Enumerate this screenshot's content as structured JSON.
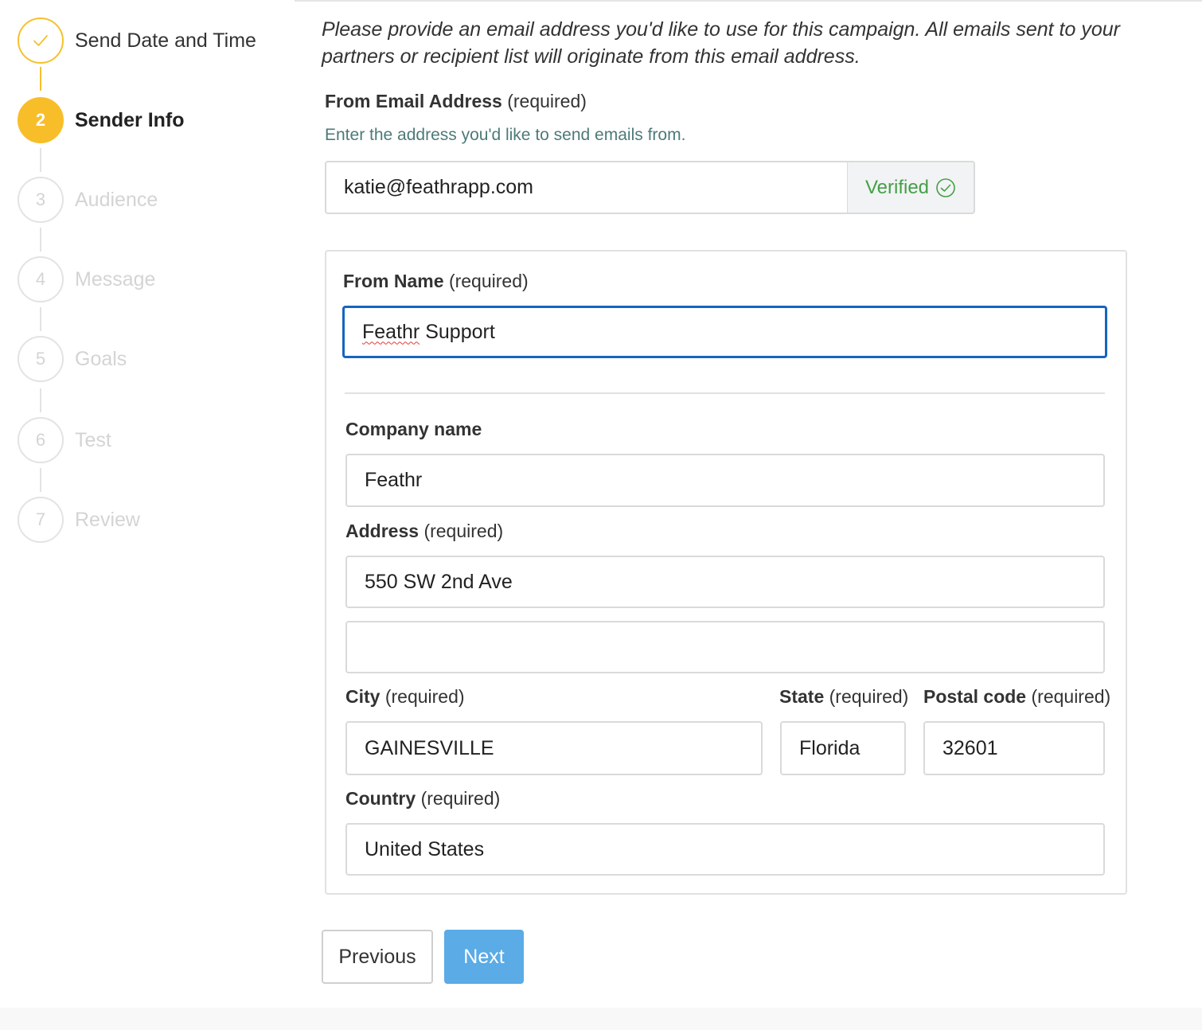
{
  "stepper": {
    "steps": [
      {
        "number": "",
        "label": "Send Date and Time",
        "state": "done"
      },
      {
        "number": "2",
        "label": "Sender Info",
        "state": "active"
      },
      {
        "number": "3",
        "label": "Audience",
        "state": "pending"
      },
      {
        "number": "4",
        "label": "Message",
        "state": "pending"
      },
      {
        "number": "5",
        "label": "Goals",
        "state": "pending"
      },
      {
        "number": "6",
        "label": "Test",
        "state": "pending"
      },
      {
        "number": "7",
        "label": "Review",
        "state": "pending"
      }
    ],
    "done_icon": "check-icon"
  },
  "form": {
    "intro": "Please provide an email address you'd like to use for this campaign. All emails sent to your partners or recipient list will originate from this email address.",
    "from_email": {
      "label": "From Email Address",
      "suffix": "(required)",
      "help": "Enter the address you'd like to send emails from.",
      "value": "katie@feathrapp.com",
      "status": "Verified",
      "status_icon": "check-circle-icon",
      "status_color": "#43a047"
    },
    "from_name": {
      "label": "From Name",
      "suffix": "(required)",
      "value_word1": "Feathr",
      "value_word2": " Support"
    },
    "company": {
      "label": "Company name",
      "value": "Feathr"
    },
    "address": {
      "label": "Address",
      "suffix": "(required)",
      "line1": "550 SW 2nd Ave",
      "line2": ""
    },
    "city": {
      "label": "City",
      "suffix": "(required)",
      "value": "GAINESVILLE"
    },
    "state": {
      "label": "State",
      "suffix": "(required)",
      "value": "Florida"
    },
    "postal": {
      "label": "Postal code",
      "suffix": "(required)",
      "value": "32601"
    },
    "country": {
      "label": "Country",
      "suffix": "(required)",
      "value": "United States"
    }
  },
  "actions": {
    "previous": "Previous",
    "next": "Next"
  },
  "colors": {
    "accent": "#f8be2a",
    "focus": "#1565c0",
    "primary_button": "#5aabe6",
    "help_text": "#4d7a78"
  }
}
